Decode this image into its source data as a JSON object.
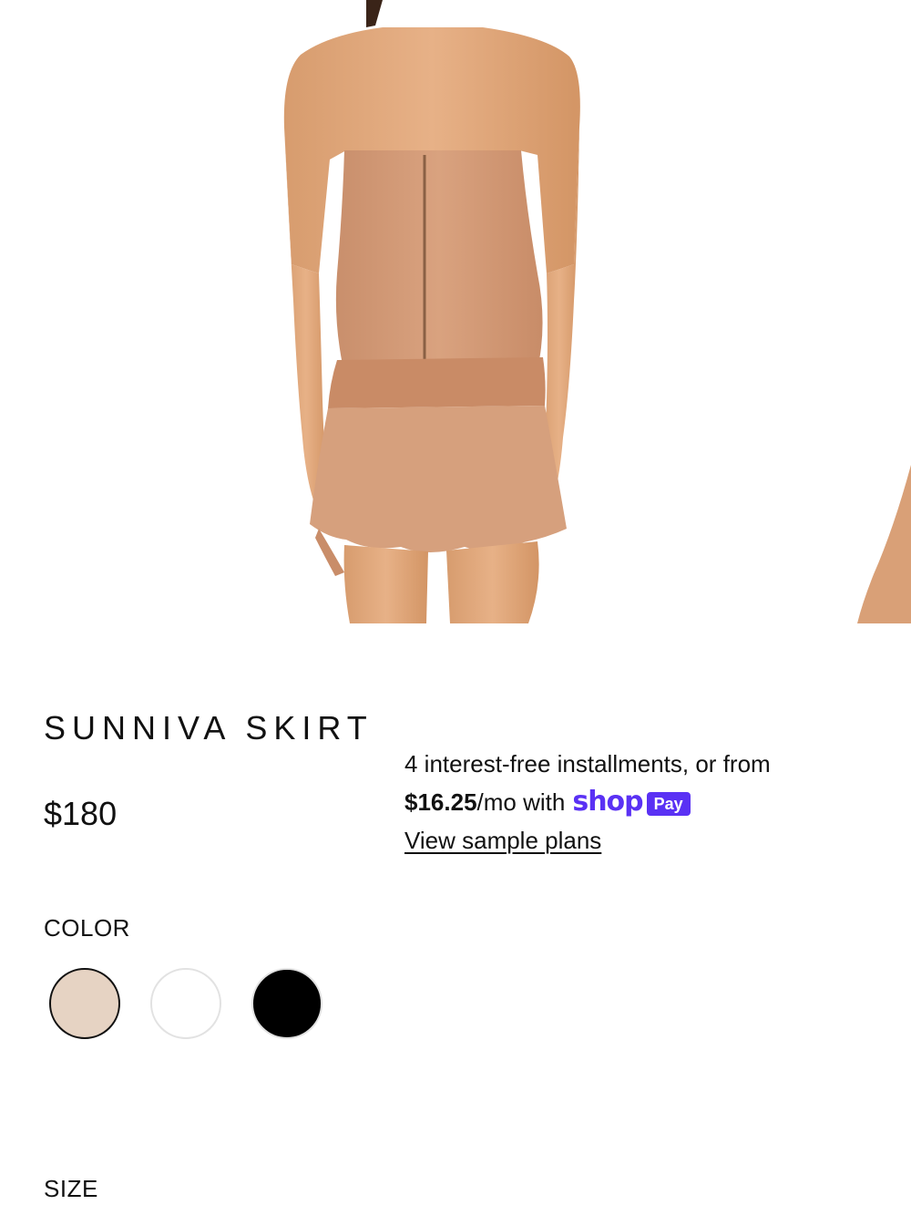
{
  "carousel": {
    "main_image_alt": "Sunniva skirt back view",
    "next_image_alt": "Next product image"
  },
  "product": {
    "title": "SUNNIVA SKIRT",
    "price": "$180"
  },
  "installments": {
    "line1": "4 interest-free installments, or from",
    "amount": "$16.25",
    "per_month_text": "/mo with",
    "shop_word": "shop",
    "pay_badge": "Pay",
    "view_plans_link": "View sample plans",
    "brand_color": "#5a31f4"
  },
  "color_selector": {
    "label": "COLOR",
    "options": [
      {
        "name": "Nude",
        "hex": "#e6d3c3",
        "selected": true
      },
      {
        "name": "White",
        "hex": "#ffffff",
        "selected": false
      },
      {
        "name": "Black",
        "hex": "#000000",
        "selected": false
      }
    ]
  },
  "size_selector": {
    "label": "SIZE"
  }
}
